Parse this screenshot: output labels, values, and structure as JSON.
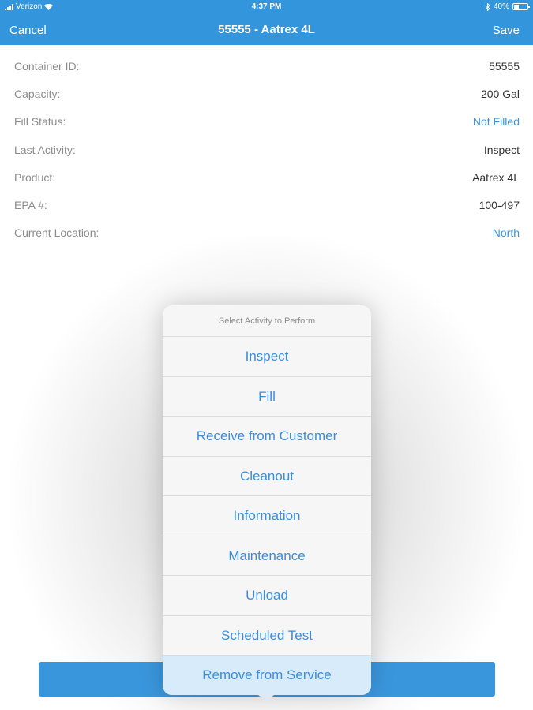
{
  "status_bar": {
    "carrier": "Verizon",
    "time": "4:37 PM",
    "battery_text": "40%",
    "battery_level": 0.4
  },
  "nav": {
    "cancel_label": "Cancel",
    "title": "55555 - Aatrex 4L",
    "save_label": "Save"
  },
  "details": [
    {
      "label": "Container ID:",
      "value": "55555",
      "value_color": "default"
    },
    {
      "label": "Capacity:",
      "value": "200 Gal",
      "value_color": "default"
    },
    {
      "label": "Fill Status:",
      "value": "Not Filled",
      "value_color": "blue"
    },
    {
      "label": "Last Activity:",
      "value": "Inspect",
      "value_color": "default"
    },
    {
      "label": "Product:",
      "value": "Aatrex 4L",
      "value_color": "default"
    },
    {
      "label": "EPA #:",
      "value": "100-497",
      "value_color": "default"
    },
    {
      "label": "Current Location:",
      "value": "North",
      "value_color": "blue"
    }
  ],
  "activity_menu": {
    "title": "Select Activity to Perform",
    "items": [
      "Inspect",
      "Fill",
      "Receive from Customer",
      "Cleanout",
      "Information",
      "Maintenance",
      "Unload",
      "Scheduled Test",
      "Remove from Service"
    ],
    "highlighted": "Remove from Service"
  },
  "colors": {
    "accent": "#3396dc",
    "link": "#3a95dc",
    "label": "#8c8c8c"
  }
}
